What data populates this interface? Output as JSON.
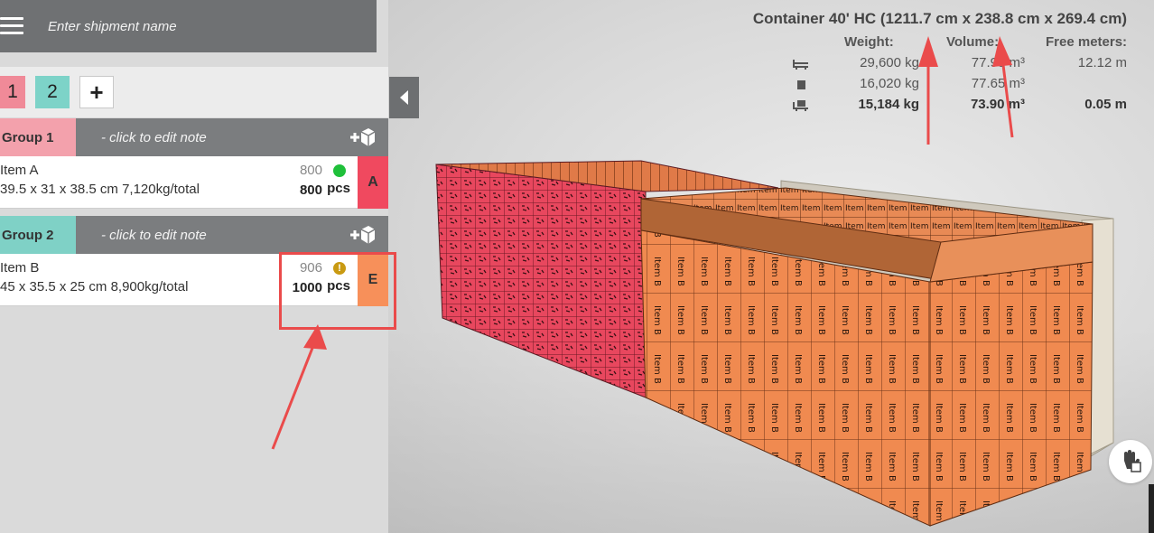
{
  "shipment": {
    "placeholder": "Enter shipment name"
  },
  "tabs": [
    {
      "label": "1",
      "color": "#f08a98"
    },
    {
      "label": "2",
      "color": "#7dd3c8"
    },
    {
      "label": "+"
    }
  ],
  "groups": [
    {
      "name": "Group 1",
      "note": "- click to edit note",
      "color": "#f3a1ac",
      "items": [
        {
          "name": "Item A",
          "dims": "39.5 x 31 x 38.5 cm 7,120kg/total",
          "loaded": "800",
          "total": "800",
          "unit": "pcs",
          "status": "ok",
          "letter": "A",
          "letter_color": "#f0495f"
        }
      ]
    },
    {
      "name": "Group 2",
      "note": "- click to edit note",
      "color": "#7fd1c6",
      "items": [
        {
          "name": "Item B",
          "dims": "45 x 35.5 x 25 cm 8,900kg/total",
          "loaded": "906",
          "total": "1000",
          "unit": "pcs",
          "status": "warning",
          "status_glyph": "!",
          "letter": "E",
          "letter_color": "#f7905a"
        }
      ]
    }
  ],
  "container": {
    "title": "Container 40' HC (1211.7 cm x 238.8 cm x 269.4 cm)",
    "headers": {
      "weight": "Weight:",
      "volume": "Volume:",
      "free": "Free meters:"
    },
    "rows": [
      {
        "icon": "pallet-truck-icon",
        "weight": "29,600 kg",
        "volume": "77.95 m³",
        "free": "12.12 m",
        "bold": false
      },
      {
        "icon": "box-icon",
        "weight": "16,020 kg",
        "volume": "77.65 m³",
        "free": "",
        "bold": false
      },
      {
        "icon": "loaded-pallet-icon",
        "weight": "15,184 kg",
        "volume": "73.90 m³",
        "free": "0.05 m",
        "bold": true
      }
    ]
  },
  "cargo_labels": {
    "item_a": "Item A",
    "item_b": "Item B"
  },
  "colors": {
    "item_a": "#e8475e",
    "item_b": "#f08a50",
    "annotation": "#ea4b4b"
  }
}
